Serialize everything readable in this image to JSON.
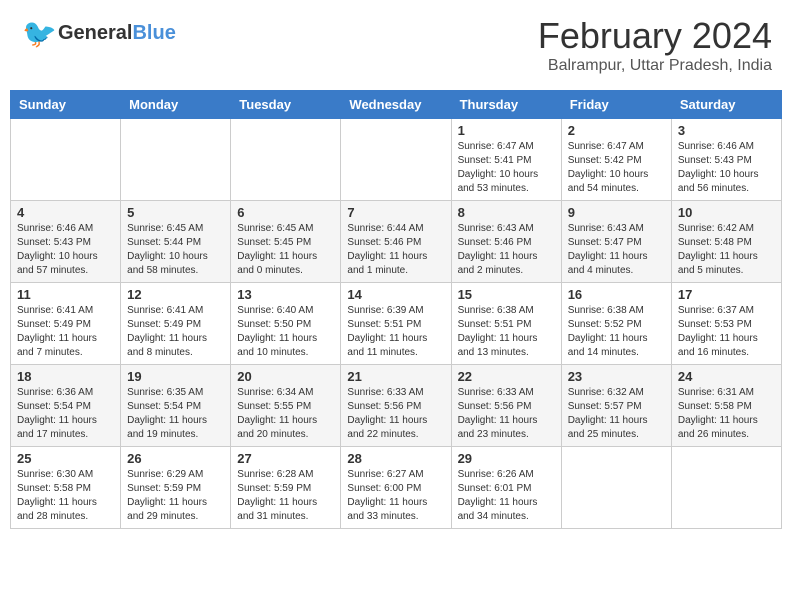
{
  "header": {
    "logo_general": "General",
    "logo_blue": "Blue",
    "title": "February 2024",
    "subtitle": "Balrampur, Uttar Pradesh, India"
  },
  "weekdays": [
    "Sunday",
    "Monday",
    "Tuesday",
    "Wednesday",
    "Thursday",
    "Friday",
    "Saturday"
  ],
  "weeks": [
    [
      {
        "day": "",
        "info": ""
      },
      {
        "day": "",
        "info": ""
      },
      {
        "day": "",
        "info": ""
      },
      {
        "day": "",
        "info": ""
      },
      {
        "day": "1",
        "info": "Sunrise: 6:47 AM\nSunset: 5:41 PM\nDaylight: 10 hours\nand 53 minutes."
      },
      {
        "day": "2",
        "info": "Sunrise: 6:47 AM\nSunset: 5:42 PM\nDaylight: 10 hours\nand 54 minutes."
      },
      {
        "day": "3",
        "info": "Sunrise: 6:46 AM\nSunset: 5:43 PM\nDaylight: 10 hours\nand 56 minutes."
      }
    ],
    [
      {
        "day": "4",
        "info": "Sunrise: 6:46 AM\nSunset: 5:43 PM\nDaylight: 10 hours\nand 57 minutes."
      },
      {
        "day": "5",
        "info": "Sunrise: 6:45 AM\nSunset: 5:44 PM\nDaylight: 10 hours\nand 58 minutes."
      },
      {
        "day": "6",
        "info": "Sunrise: 6:45 AM\nSunset: 5:45 PM\nDaylight: 11 hours\nand 0 minutes."
      },
      {
        "day": "7",
        "info": "Sunrise: 6:44 AM\nSunset: 5:46 PM\nDaylight: 11 hours\nand 1 minute."
      },
      {
        "day": "8",
        "info": "Sunrise: 6:43 AM\nSunset: 5:46 PM\nDaylight: 11 hours\nand 2 minutes."
      },
      {
        "day": "9",
        "info": "Sunrise: 6:43 AM\nSunset: 5:47 PM\nDaylight: 11 hours\nand 4 minutes."
      },
      {
        "day": "10",
        "info": "Sunrise: 6:42 AM\nSunset: 5:48 PM\nDaylight: 11 hours\nand 5 minutes."
      }
    ],
    [
      {
        "day": "11",
        "info": "Sunrise: 6:41 AM\nSunset: 5:49 PM\nDaylight: 11 hours\nand 7 minutes."
      },
      {
        "day": "12",
        "info": "Sunrise: 6:41 AM\nSunset: 5:49 PM\nDaylight: 11 hours\nand 8 minutes."
      },
      {
        "day": "13",
        "info": "Sunrise: 6:40 AM\nSunset: 5:50 PM\nDaylight: 11 hours\nand 10 minutes."
      },
      {
        "day": "14",
        "info": "Sunrise: 6:39 AM\nSunset: 5:51 PM\nDaylight: 11 hours\nand 11 minutes."
      },
      {
        "day": "15",
        "info": "Sunrise: 6:38 AM\nSunset: 5:51 PM\nDaylight: 11 hours\nand 13 minutes."
      },
      {
        "day": "16",
        "info": "Sunrise: 6:38 AM\nSunset: 5:52 PM\nDaylight: 11 hours\nand 14 minutes."
      },
      {
        "day": "17",
        "info": "Sunrise: 6:37 AM\nSunset: 5:53 PM\nDaylight: 11 hours\nand 16 minutes."
      }
    ],
    [
      {
        "day": "18",
        "info": "Sunrise: 6:36 AM\nSunset: 5:54 PM\nDaylight: 11 hours\nand 17 minutes."
      },
      {
        "day": "19",
        "info": "Sunrise: 6:35 AM\nSunset: 5:54 PM\nDaylight: 11 hours\nand 19 minutes."
      },
      {
        "day": "20",
        "info": "Sunrise: 6:34 AM\nSunset: 5:55 PM\nDaylight: 11 hours\nand 20 minutes."
      },
      {
        "day": "21",
        "info": "Sunrise: 6:33 AM\nSunset: 5:56 PM\nDaylight: 11 hours\nand 22 minutes."
      },
      {
        "day": "22",
        "info": "Sunrise: 6:33 AM\nSunset: 5:56 PM\nDaylight: 11 hours\nand 23 minutes."
      },
      {
        "day": "23",
        "info": "Sunrise: 6:32 AM\nSunset: 5:57 PM\nDaylight: 11 hours\nand 25 minutes."
      },
      {
        "day": "24",
        "info": "Sunrise: 6:31 AM\nSunset: 5:58 PM\nDaylight: 11 hours\nand 26 minutes."
      }
    ],
    [
      {
        "day": "25",
        "info": "Sunrise: 6:30 AM\nSunset: 5:58 PM\nDaylight: 11 hours\nand 28 minutes."
      },
      {
        "day": "26",
        "info": "Sunrise: 6:29 AM\nSunset: 5:59 PM\nDaylight: 11 hours\nand 29 minutes."
      },
      {
        "day": "27",
        "info": "Sunrise: 6:28 AM\nSunset: 5:59 PM\nDaylight: 11 hours\nand 31 minutes."
      },
      {
        "day": "28",
        "info": "Sunrise: 6:27 AM\nSunset: 6:00 PM\nDaylight: 11 hours\nand 33 minutes."
      },
      {
        "day": "29",
        "info": "Sunrise: 6:26 AM\nSunset: 6:01 PM\nDaylight: 11 hours\nand 34 minutes."
      },
      {
        "day": "",
        "info": ""
      },
      {
        "day": "",
        "info": ""
      }
    ]
  ]
}
